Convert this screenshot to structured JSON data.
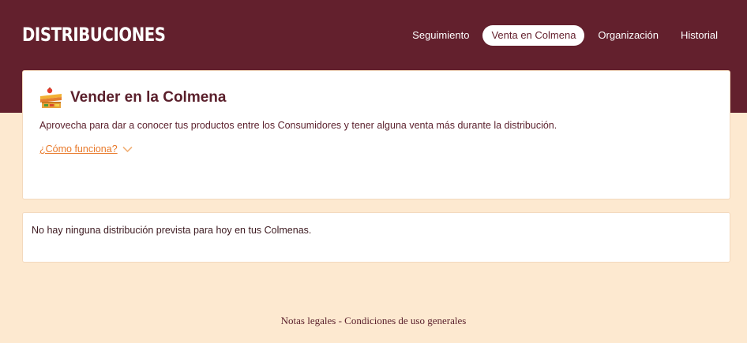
{
  "header": {
    "logo": "DISTRIBUCIONES",
    "nav": [
      {
        "label": "Seguimiento",
        "active": false
      },
      {
        "label": "Venta en Colmena",
        "active": true
      },
      {
        "label": "Organización",
        "active": false
      },
      {
        "label": "Historial",
        "active": false
      }
    ]
  },
  "sell_card": {
    "icon": "market-stall-icon",
    "title": "Vender en la Colmena",
    "description": "Aprovecha para dar a conocer tus productos entre los Consumidores y tener alguna venta más durante la distribución.",
    "how_link": "¿Cómo funciona?"
  },
  "status_card": {
    "message": "No hay ninguna distribución prevista para hoy en tus Colmenas."
  },
  "footer": {
    "legal": "Notas legales",
    "separator": " - ",
    "terms": "Condiciones de uso generales"
  },
  "colors": {
    "header_bg": "#63202d",
    "page_bg": "#fde9d0",
    "accent": "#e8792a"
  }
}
